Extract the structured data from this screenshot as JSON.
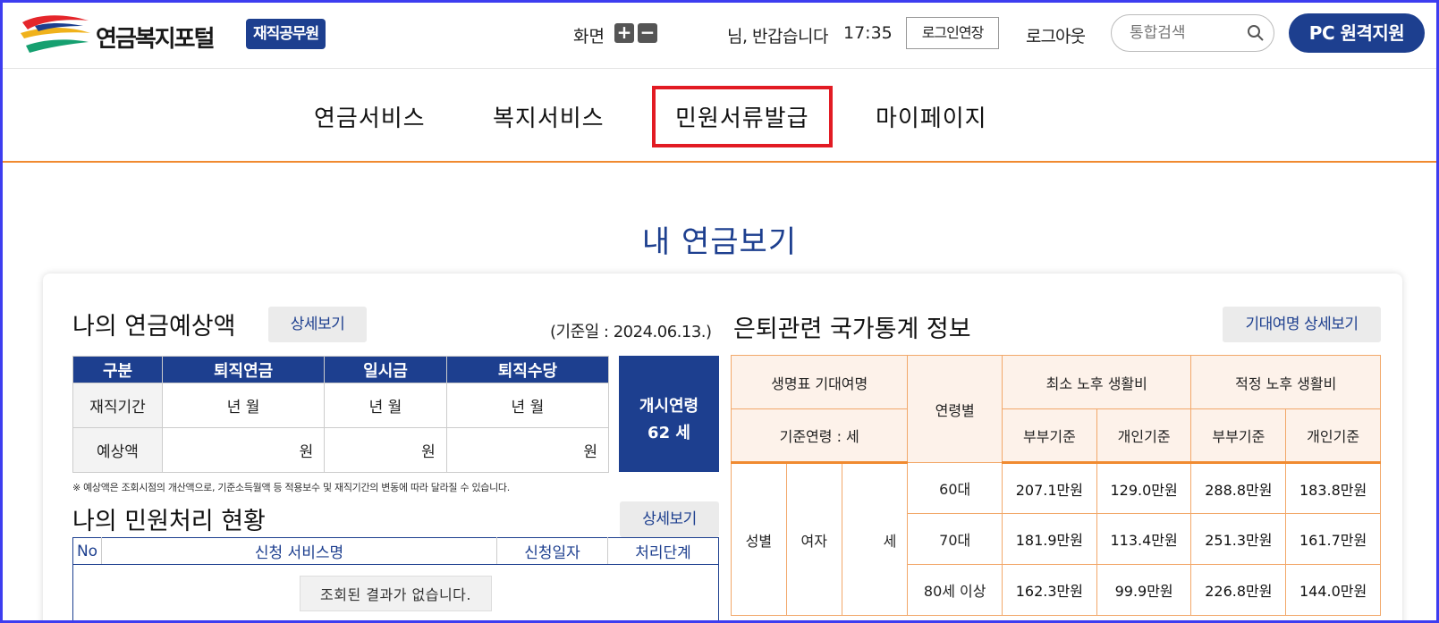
{
  "header": {
    "logo_text": "연금복지포털",
    "role_badge": "재직공무원",
    "zoom_label": "화면",
    "zoom_in": "+",
    "zoom_out": "−",
    "greeting": "님, 반갑습니다",
    "clock": "17:35",
    "extend_login": "로그인연장",
    "logout": "로그아웃",
    "search_placeholder": "통합검색",
    "remote_support": "PC 원격지원"
  },
  "nav": {
    "items": [
      "연금서비스",
      "복지서비스",
      "민원서류발급",
      "마이페이지"
    ],
    "active_index": 2
  },
  "page_title": "내 연금보기",
  "pension": {
    "title": "나의 연금예상액",
    "detail_btn": "상세보기",
    "base_date": "(기준일 : 2024.06.13.)",
    "headers": [
      "구분",
      "퇴직연금",
      "일시금",
      "퇴직수당"
    ],
    "rows": [
      {
        "label": "재직기간",
        "cells": [
          "년     월",
          "년     월",
          "년     월"
        ]
      },
      {
        "label": "예상액",
        "cells": [
          "원",
          "원",
          "원"
        ]
      }
    ],
    "start_age_label": "개시연령",
    "start_age_value": "62 세",
    "note": "※ 예상액은 조회시점의 개산액으로, 기준소득월액 등 적용보수 및 재직기간의 변동에 따라 달라질 수 있습니다."
  },
  "civil": {
    "title": "나의 민원처리 현황",
    "detail_btn": "상세보기",
    "headers": [
      "No",
      "신청 서비스명",
      "신청일자",
      "처리단계"
    ],
    "empty_msg": "조회된 결과가 없습니다."
  },
  "stats": {
    "title": "은퇴관련 국가통계 정보",
    "detail_btn": "기대여명 상세보기",
    "head_life": "생명표 기대여명",
    "head_base_age": "기준연령 :    세",
    "head_age_group": "연령별",
    "head_min": "최소 노후 생활비",
    "head_adequate": "적정 노후 생활비",
    "head_couple": "부부기준",
    "head_individual": "개인기준",
    "row_label_gender": "성별",
    "row_gender_value": "여자",
    "row_years": "세",
    "rows": [
      {
        "age": "60대",
        "min_couple": "207.1만원",
        "min_individual": "129.0만원",
        "adq_couple": "288.8만원",
        "adq_individual": "183.8만원"
      },
      {
        "age": "70대",
        "min_couple": "181.9만원",
        "min_individual": "113.4만원",
        "adq_couple": "251.3만원",
        "adq_individual": "161.7만원"
      },
      {
        "age": "80세 이상",
        "min_couple": "162.3만원",
        "min_individual": "99.9만원",
        "adq_couple": "226.8만원",
        "adq_individual": "144.0만원"
      }
    ]
  }
}
